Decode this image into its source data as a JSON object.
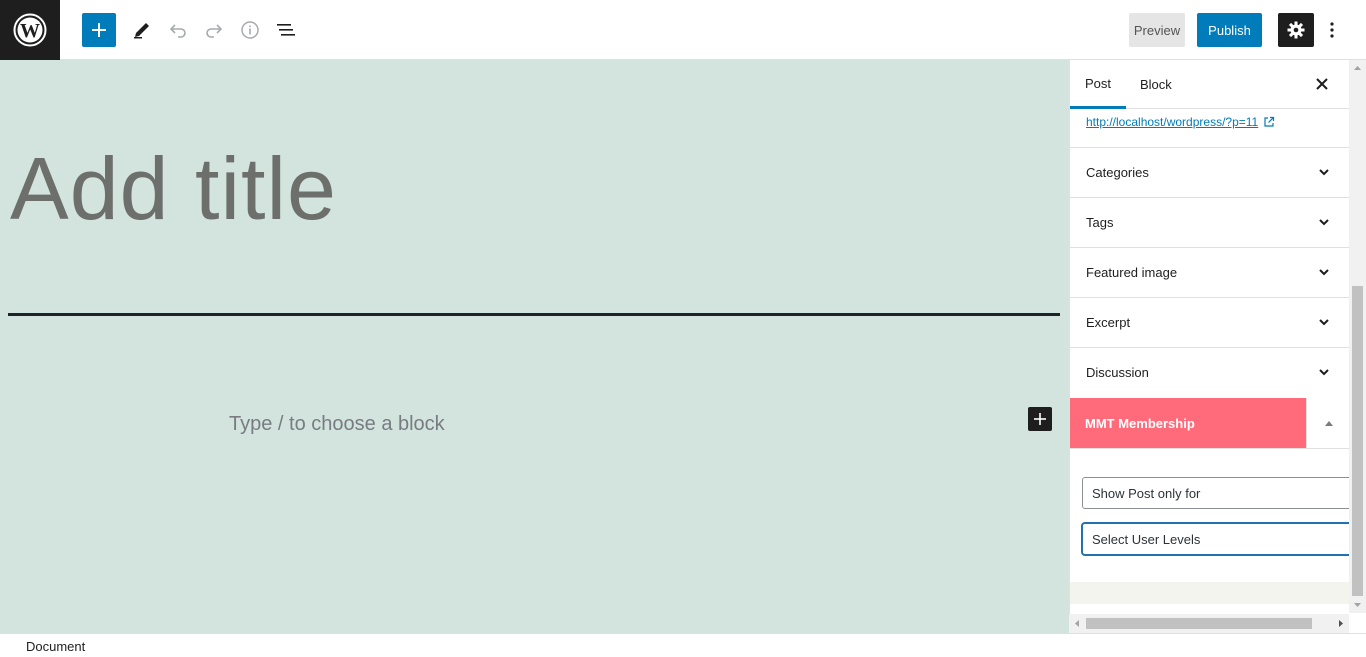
{
  "toolbar": {
    "logo_icon": "wordpress-logo",
    "add_block_icon": "plus-icon",
    "tools_icon": "pencil-icon",
    "undo_icon": "undo-icon",
    "redo_icon": "redo-icon",
    "details_icon": "info-icon",
    "list_view_icon": "list-view-icon",
    "preview_label": "Preview",
    "publish_label": "Publish",
    "settings_icon": "gear-icon",
    "more_icon": "more-vertical-icon",
    "accent_color": "#007cba"
  },
  "editor": {
    "title_placeholder": "Add title",
    "block_prompt": "Type / to choose a block",
    "inline_add_icon": "plus-icon",
    "canvas_color": "#d2e4dd"
  },
  "sidebar": {
    "tabs": [
      {
        "label": "Post",
        "active": true
      },
      {
        "label": "Block",
        "active": false
      }
    ],
    "close_icon": "close-icon",
    "permalink": "http://localhost/wordpress/?p=11",
    "permalink_icon": "external-link-icon",
    "panels": [
      {
        "label": "Categories"
      },
      {
        "label": "Tags"
      },
      {
        "label": "Featured image"
      },
      {
        "label": "Excerpt"
      },
      {
        "label": "Discussion"
      }
    ],
    "membership": {
      "title": "MMT Membership",
      "header_color": "#ff6b7a",
      "toggle_icon": "caret-up-icon",
      "show_select": "Show Post only for",
      "levels_select": "Select User Levels"
    }
  },
  "footer": {
    "breadcrumb": "Document"
  }
}
